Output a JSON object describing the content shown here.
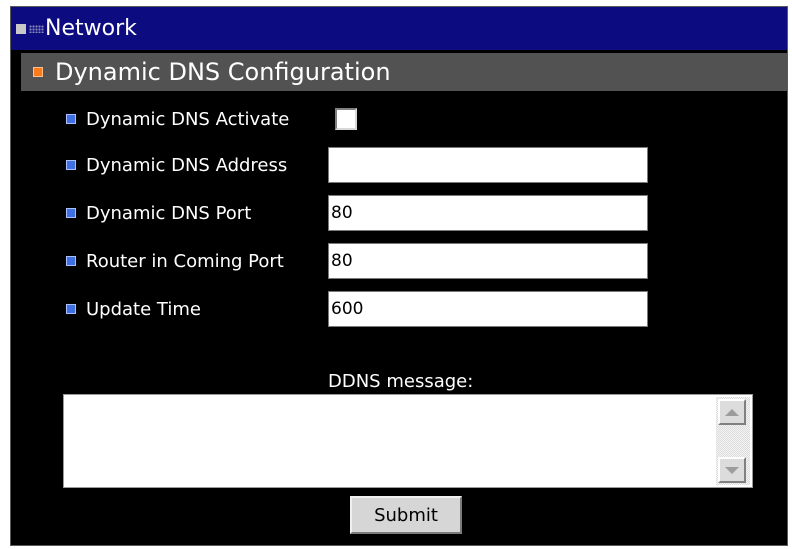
{
  "window": {
    "title": "Network",
    "title_bar_color": "#0c0c80"
  },
  "section": {
    "title": "Dynamic DNS Configuration",
    "accent_color": "#ff7a1a"
  },
  "fields": {
    "activate": {
      "label": "Dynamic DNS Activate",
      "checked": false
    },
    "address": {
      "label": "Dynamic DNS Address",
      "value": ""
    },
    "port": {
      "label": "Dynamic DNS Port",
      "value": "80"
    },
    "router_port": {
      "label": "Router in Coming Port",
      "value": "80"
    },
    "update_time": {
      "label": "Update Time",
      "value": "600"
    }
  },
  "message": {
    "label": "DDNS message:",
    "value": ""
  },
  "actions": {
    "submit_label": "Submit"
  },
  "icons": {
    "title": "window-menu-icon",
    "section_bullet": "orange-square-bullet-icon",
    "field_bullet": "blue-square-bullet-icon",
    "scroll_up": "arrow-up-icon",
    "scroll_down": "arrow-down-icon"
  }
}
